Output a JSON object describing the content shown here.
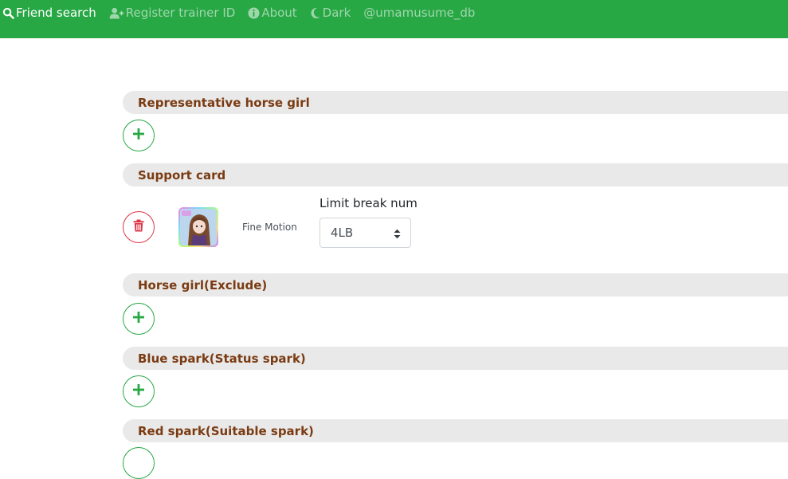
{
  "navbar": {
    "items": [
      {
        "label": "Friend search",
        "icon": "search-icon",
        "active": true
      },
      {
        "label": "Register trainer ID",
        "icon": "user-plus-icon",
        "active": false
      },
      {
        "label": "About",
        "icon": "info-circle-icon",
        "active": false
      },
      {
        "label": "Dark",
        "icon": "moon-icon",
        "active": false
      },
      {
        "label": "@umamusume_db",
        "icon": "",
        "active": false
      }
    ],
    "color": "#28a745"
  },
  "sections": {
    "representative": {
      "title": "Representative horse girl"
    },
    "support_card": {
      "title": "Support card",
      "card_name": "Fine Motion",
      "limit_break_label": "Limit break num",
      "limit_break_value": "4LB"
    },
    "exclude": {
      "title": "Horse girl(Exclude)"
    },
    "blue_spark": {
      "title": "Blue spark(Status spark)"
    },
    "red_spark": {
      "title": "Red spark(Suitable spark)"
    }
  },
  "colors": {
    "section_title": "#7a3b12",
    "section_bg": "#e9e9e9",
    "add": "#28a745",
    "delete": "#dc3545"
  }
}
